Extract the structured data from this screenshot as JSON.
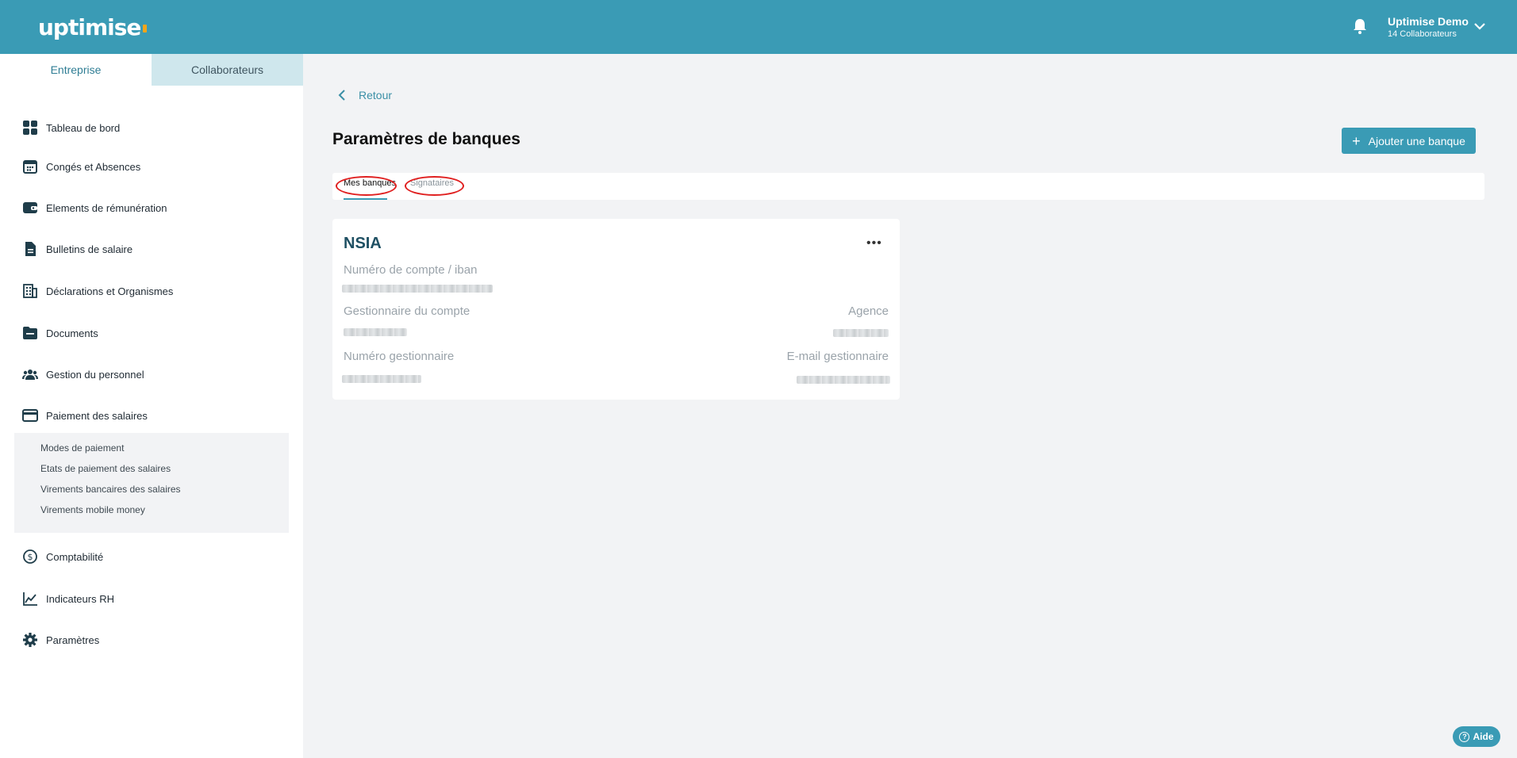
{
  "header": {
    "logo": "uptimise",
    "user_name": "Uptimise Demo",
    "user_sub": "14 Collaborateurs"
  },
  "sidebar": {
    "tabs": [
      {
        "label": "Entreprise",
        "active": true
      },
      {
        "label": "Collaborateurs",
        "active": false
      }
    ],
    "items": [
      {
        "label": "Tableau de bord",
        "icon": "dashboard-icon"
      },
      {
        "label": "Congés et Absences",
        "icon": "calendar-icon"
      },
      {
        "label": "Elements de rémunération",
        "icon": "wallet-icon"
      },
      {
        "label": "Bulletins de salaire",
        "icon": "payslip-icon"
      },
      {
        "label": "Déclarations et Organismes",
        "icon": "building-icon"
      },
      {
        "label": "Documents",
        "icon": "folder-icon"
      },
      {
        "label": "Gestion du personnel",
        "icon": "people-icon"
      },
      {
        "label": "Paiement des salaires",
        "icon": "card-icon"
      },
      {
        "label": "Comptabilité",
        "icon": "dollar-circle-icon"
      },
      {
        "label": "Indicateurs RH",
        "icon": "chart-line-icon"
      },
      {
        "label": "Paramètres",
        "icon": "gear-icon"
      }
    ],
    "subitems": [
      "Modes de paiement",
      "Etats de paiement des salaires",
      "Virements bancaires des salaires",
      "Virements mobile money"
    ]
  },
  "main": {
    "back_label": "Retour",
    "title": "Paramètres de banques",
    "add_button": "Ajouter une banque",
    "tabs": [
      {
        "label": "Mes banques",
        "active": true
      },
      {
        "label": "Signataires",
        "active": false
      }
    ]
  },
  "bank_card": {
    "name": "NSIA",
    "account_label": "Numéro de compte / iban",
    "manager_label": "Gestionnaire du compte",
    "agency_label": "Agence",
    "manager_number_label": "Numéro gestionnaire",
    "manager_email_label": "E-mail gestionnaire"
  },
  "help_label": "Aide",
  "colors": {
    "brand": "#3a9bb5",
    "tab_inactive_bg": "#cfe7ed",
    "annotation": "#e02020"
  }
}
